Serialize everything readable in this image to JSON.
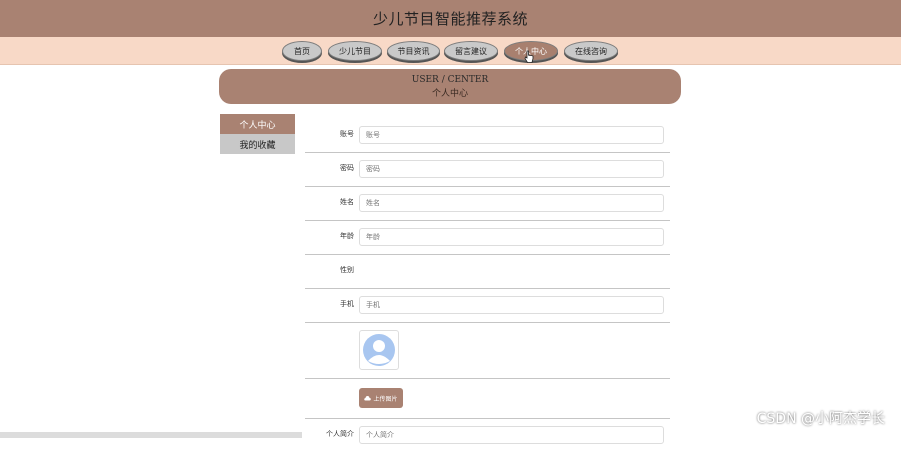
{
  "header": {
    "title": "少儿节目智能推荐系统"
  },
  "nav": {
    "items": [
      {
        "label": "首页"
      },
      {
        "label": "少儿节目"
      },
      {
        "label": "节目资讯"
      },
      {
        "label": "留言建议"
      },
      {
        "label": "个人中心"
      },
      {
        "label": "在线咨询"
      }
    ],
    "active": "个人中心"
  },
  "banner": {
    "en": "USER / CENTER",
    "cn": "个人中心"
  },
  "sidebar": {
    "items": [
      {
        "label": "个人中心"
      },
      {
        "label": "我的收藏"
      }
    ]
  },
  "form": {
    "account": {
      "label": "账号",
      "placeholder": "账号"
    },
    "password": {
      "label": "密码",
      "placeholder": "密码"
    },
    "name": {
      "label": "姓名",
      "placeholder": "姓名"
    },
    "age": {
      "label": "年龄",
      "placeholder": "年龄"
    },
    "gender": {
      "label": "性别"
    },
    "phone": {
      "label": "手机",
      "placeholder": "手机"
    },
    "upload_label": "上传图片",
    "intro": {
      "label": "个人简介",
      "placeholder": "个人简介"
    }
  },
  "colors": {
    "accent": "#a98272",
    "nav_bg": "#f8d9c7",
    "button_inactive": "#c9c9c9"
  },
  "watermark": "CSDN @小阿杰学长"
}
